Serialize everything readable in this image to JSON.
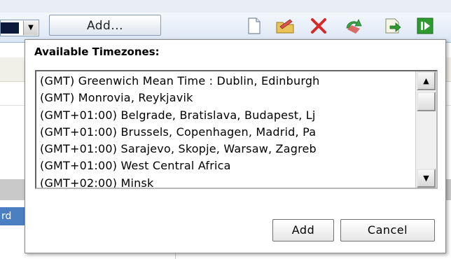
{
  "toolbar": {
    "add_label": "Add...",
    "icons": [
      "new-document-icon",
      "edit-folder-icon",
      "delete-icon",
      "refresh-icon",
      "export-icon",
      "run-icon"
    ]
  },
  "background": {
    "left_text": "rd"
  },
  "dialog": {
    "title": "Available Timezones:",
    "timezones": [
      "(GMT) Greenwich Mean Time : Dublin, Edinburgh",
      "(GMT) Monrovia, Reykjavik",
      "(GMT+01:00) Belgrade, Bratislava, Budapest, Lj",
      "(GMT+01:00) Brussels, Copenhagen, Madrid, Pa",
      "(GMT+01:00) Sarajevo, Skopje, Warsaw, Zagreb",
      "(GMT+01:00) West Central Africa",
      "(GMT+02:00) Minsk"
    ],
    "add_label": "Add",
    "cancel_label": "Cancel"
  },
  "colors": {
    "toolbar_bg": "#dbe6f4",
    "delete_red": "#d62828",
    "run_green": "#2e9b2e"
  }
}
